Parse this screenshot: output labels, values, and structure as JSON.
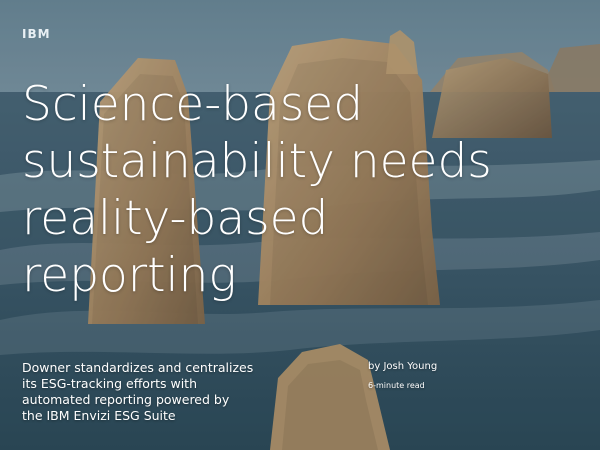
{
  "brand": {
    "logo_text": "IBM"
  },
  "hero": {
    "headline_lines": [
      "Science-based",
      "sustainability needs",
      "reality-based",
      "reporting"
    ],
    "dek_lines": [
      "Downer standardizes and centralizes",
      "its ESG-tracking efforts with",
      "automated reporting powered by",
      "the IBM Envizi ESG Suite"
    ],
    "byline": "by Josh Young",
    "read_time": "6-minute read"
  },
  "colors": {
    "text": "#ffffff",
    "sea": "#4c6a7a",
    "sky": "#8ea6b4",
    "rock": "#b59a72"
  }
}
